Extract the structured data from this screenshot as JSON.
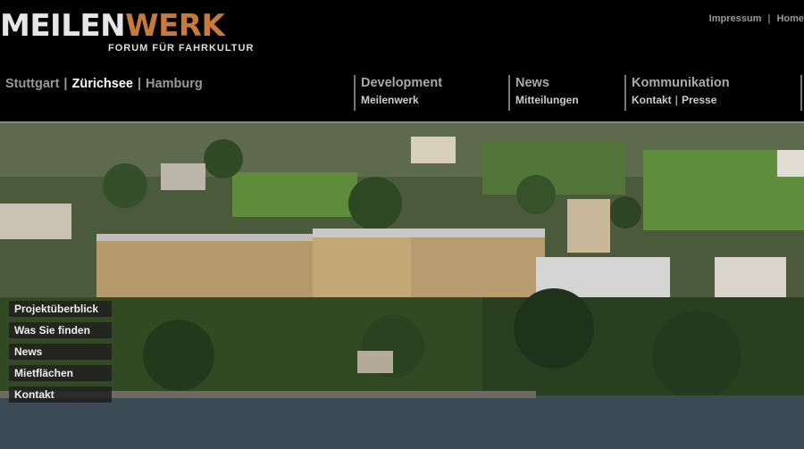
{
  "logo": {
    "part1": "MEILEN",
    "part2": "WERK",
    "subtitle": "FORUM FÜR FAHRKULTUR"
  },
  "toplinks": {
    "impressum": "Impressum",
    "separator": "|",
    "home": "Home"
  },
  "cities": {
    "stuttgart": "Stuttgart",
    "zuerichsee": "Zürichsee",
    "hamburg": "Hamburg",
    "separator": "|"
  },
  "nav": {
    "development": {
      "title": "Development",
      "sub": "Meilenwerk"
    },
    "news": {
      "title": "News",
      "sub": "Mitteilungen"
    },
    "kommunikation": {
      "title": "Kommunikation",
      "sub1": "Kontakt",
      "separator": "|",
      "sub2": "Presse"
    }
  },
  "sidemenu": [
    "Projektüberblick",
    "Was Sie finden",
    "News",
    "Mietflächen",
    "Kontakt"
  ],
  "colors": {
    "background": "#000000",
    "accent": "#c87a3c",
    "nav_text": "#aaaaaa"
  }
}
